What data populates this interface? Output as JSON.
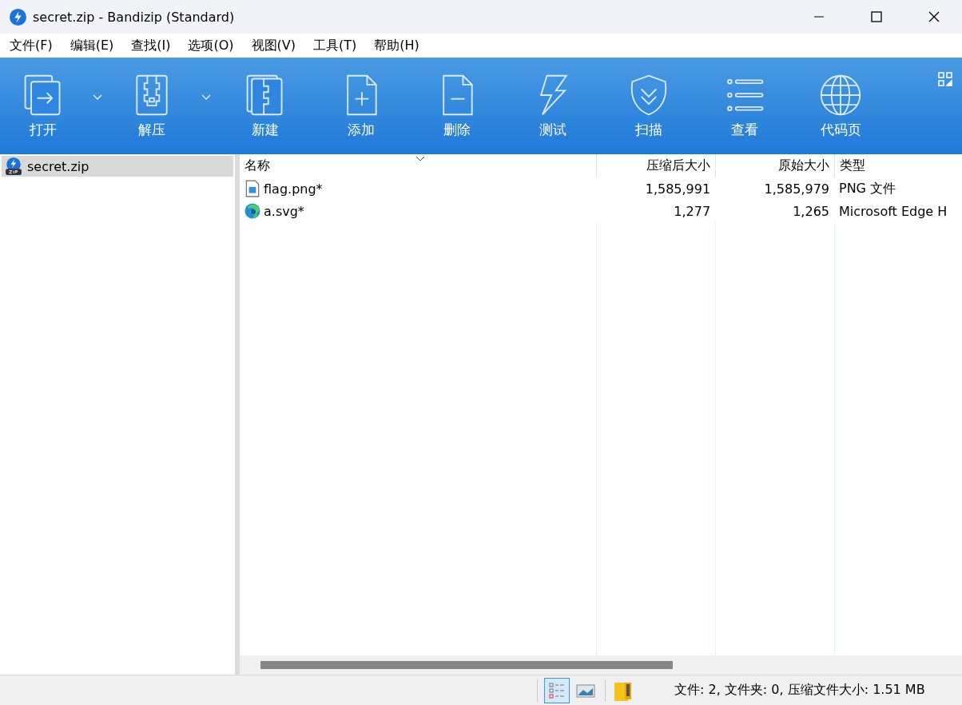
{
  "window": {
    "title": "secret.zip - Bandizip (Standard)"
  },
  "menu": [
    "文件(F)",
    "编辑(E)",
    "查找(I)",
    "选项(O)",
    "视图(V)",
    "工具(T)",
    "帮助(H)"
  ],
  "toolbar": [
    {
      "label": "打开",
      "dropdown": true
    },
    {
      "label": "解压",
      "dropdown": true
    },
    {
      "label": "新建",
      "dropdown": false
    },
    {
      "label": "添加",
      "dropdown": false
    },
    {
      "label": "删除",
      "dropdown": false
    },
    {
      "label": "测试",
      "dropdown": false
    },
    {
      "label": "扫描",
      "dropdown": false
    },
    {
      "label": "查看",
      "dropdown": false
    },
    {
      "label": "代码页",
      "dropdown": false
    }
  ],
  "tree": [
    {
      "label": "secret.zip",
      "selected": true
    }
  ],
  "table": {
    "columns": [
      "名称",
      "压缩后大小",
      "原始大小",
      "类型"
    ],
    "rows": [
      {
        "name": "flag.png*",
        "kind": "image",
        "packed": "1,585,991",
        "size": "1,585,979",
        "type": "PNG 文件",
        "selected": false
      },
      {
        "name": "a.svg*",
        "kind": "edge",
        "packed": "1,277",
        "size": "1,265",
        "type": "Microsoft Edge H",
        "selected": false
      }
    ]
  },
  "status_bar": {
    "views": [
      {
        "selected": true
      },
      {
        "selected": false
      }
    ],
    "text": "文件: 2, 文件夹: 0, 压缩文件大小: 1.51 MB"
  }
}
